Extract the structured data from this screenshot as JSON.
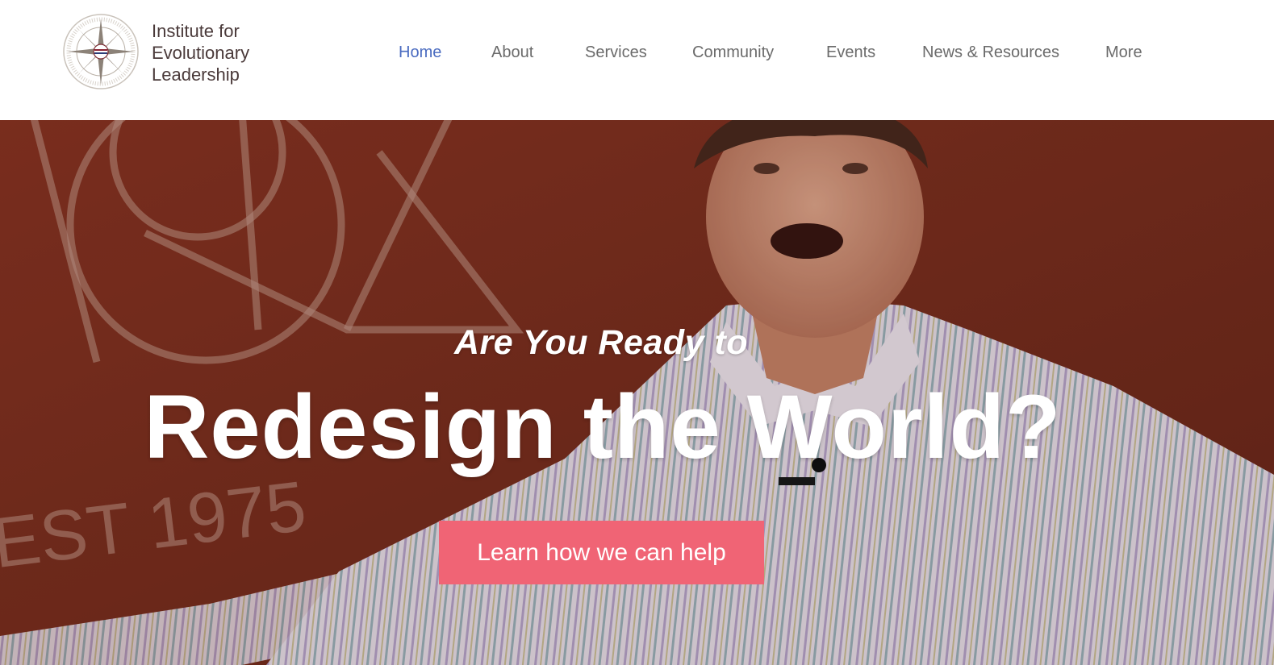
{
  "brand": {
    "name_lines": [
      "Institute for",
      "Evolutionary",
      "Leadership"
    ],
    "logo_icon": "compass-rose-icon"
  },
  "nav": {
    "items": [
      {
        "label": "Home",
        "active": true
      },
      {
        "label": "About",
        "active": false
      },
      {
        "label": "Services",
        "active": false
      },
      {
        "label": "Community",
        "active": false
      },
      {
        "label": "Events",
        "active": false
      },
      {
        "label": "News & Resources",
        "active": false
      },
      {
        "label": "More",
        "active": false
      }
    ],
    "active_color": "#4a6bc0",
    "color": "#6b6b6b"
  },
  "hero": {
    "subtitle": "Are You Ready to",
    "title": "Redesign the World?",
    "cta_label": "Learn how we can help",
    "cta_color": "#f06475",
    "background_color": "#7a3020",
    "backdrop_text": "EST 1975"
  }
}
